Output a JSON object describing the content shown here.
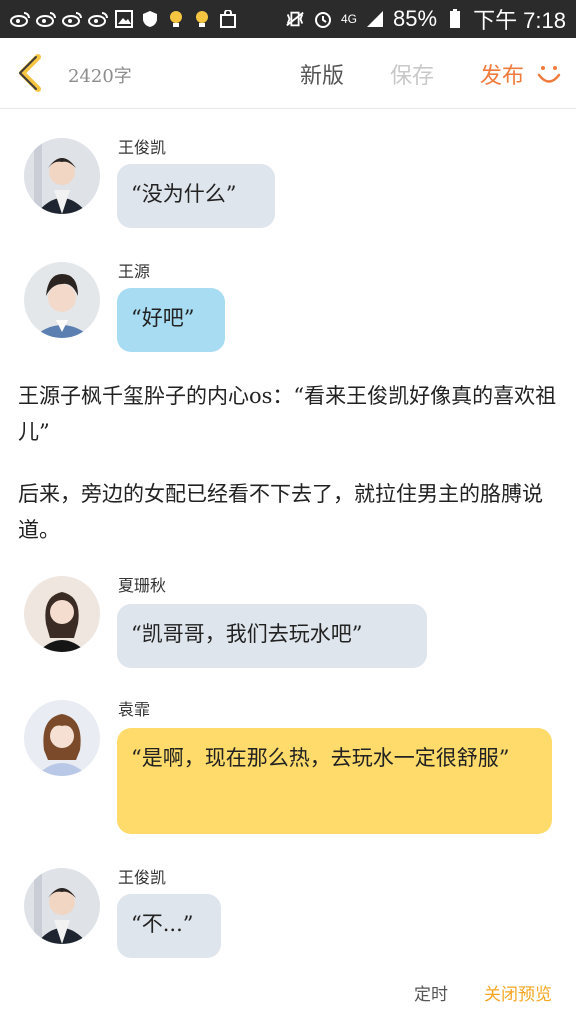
{
  "status_bar": {
    "battery": "85%",
    "time": "下午 7:18",
    "network": "4G",
    "icons": [
      "weibo-icon",
      "weibo-icon",
      "weibo-icon",
      "weibo-icon",
      "image-icon",
      "shield-icon",
      "lightbulb-icon",
      "lightbulb-icon",
      "bag-icon",
      "vibrate-icon",
      "alarm-icon",
      "signal-icon",
      "battery-icon"
    ]
  },
  "toolbar": {
    "word_count": "2420字",
    "new_label": "新版",
    "save_label": "保存",
    "publish_label": "发布",
    "accent": "#f07b3c"
  },
  "messages": [
    {
      "name": "王俊凯",
      "text": "“没为什么”",
      "color": "#dfe5ec"
    },
    {
      "name": "王源",
      "text": "“好吧”",
      "color": "#a8dcf3"
    },
    {
      "name": "夏珊秋",
      "text": "“凯哥哥，我们去玩水吧”",
      "color": "#dfe5ec"
    },
    {
      "name": "袁霏",
      "text": "“是啊，现在那么热，去玩水一定很舒服”",
      "color": "#fedb6a"
    },
    {
      "name": "王俊凯",
      "text": "“不...”",
      "color": "#dfe5ec"
    }
  ],
  "paragraphs": [
    "王源子枫千玺肸子的内心os：“看来王俊凯好像真的喜欢祖儿”",
    "后来，旁边的女配已经看不下去了，就拉住男主的胳膊说道。"
  ],
  "footer": {
    "timer_label": "定时",
    "close_preview_label": "关闭预览"
  }
}
